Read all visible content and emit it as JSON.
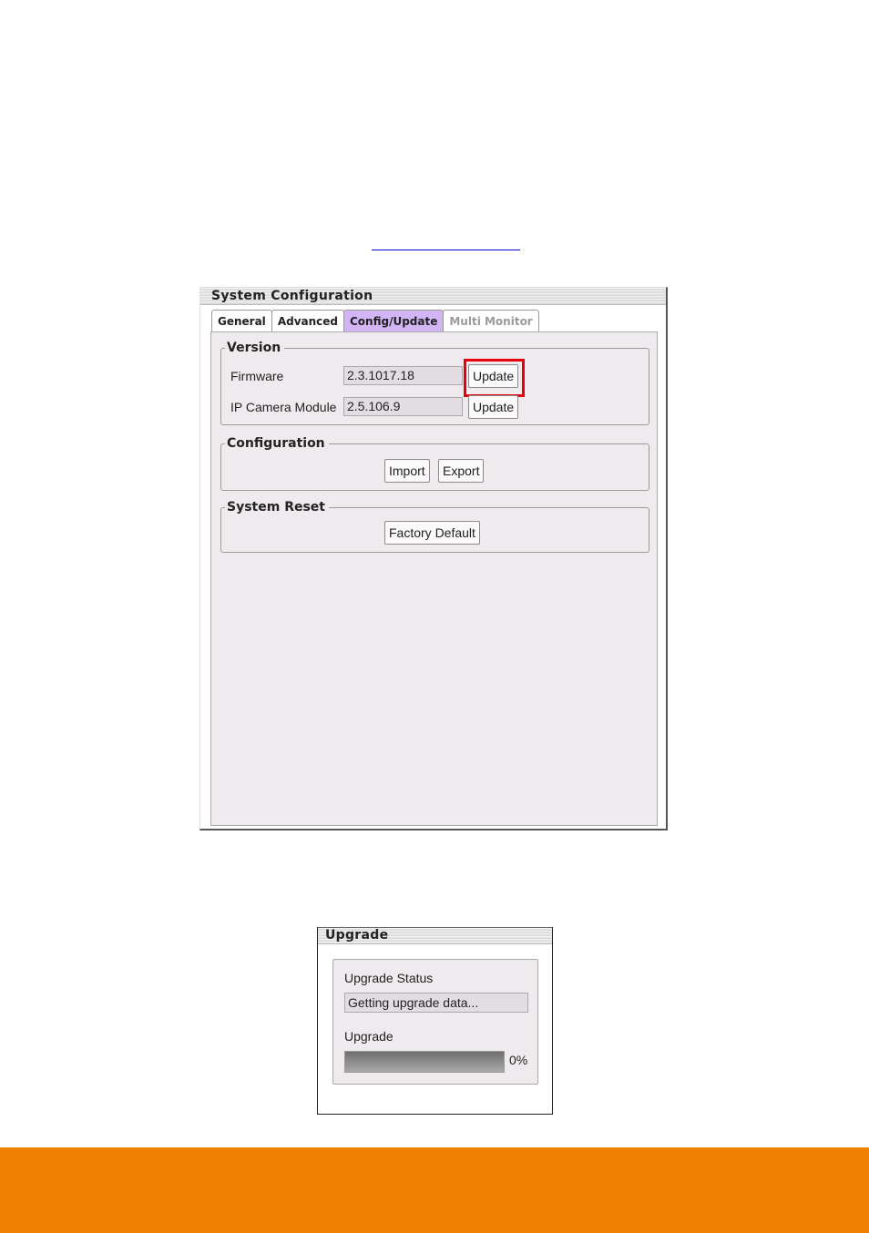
{
  "colors": {
    "footer": "#ef8200",
    "active_tab": "#d3b5f5",
    "highlight": "#e8000d",
    "link": "#0000cc"
  },
  "system_config": {
    "title": "System Configuration",
    "tabs": [
      {
        "label": "General",
        "state": "normal"
      },
      {
        "label": "Advanced",
        "state": "normal"
      },
      {
        "label": "Config/Update",
        "state": "active"
      },
      {
        "label": "Multi Monitor",
        "state": "disabled"
      }
    ],
    "version": {
      "legend": "Version",
      "firmware": {
        "label": "Firmware",
        "value": "2.3.1017.18",
        "button": "Update",
        "highlighted": true
      },
      "ip_camera": {
        "label": "IP Camera Module",
        "value": "2.5.106.9",
        "button": "Update"
      }
    },
    "configuration": {
      "legend": "Configuration",
      "import_label": "Import",
      "export_label": "Export"
    },
    "system_reset": {
      "legend": "System Reset",
      "factory_default_label": "Factory Default"
    }
  },
  "upgrade_dialog": {
    "title": "Upgrade",
    "status_label": "Upgrade Status",
    "status_value": "Getting upgrade data...",
    "progress_label": "Upgrade",
    "progress_percent": 0,
    "progress_text": "0%"
  }
}
